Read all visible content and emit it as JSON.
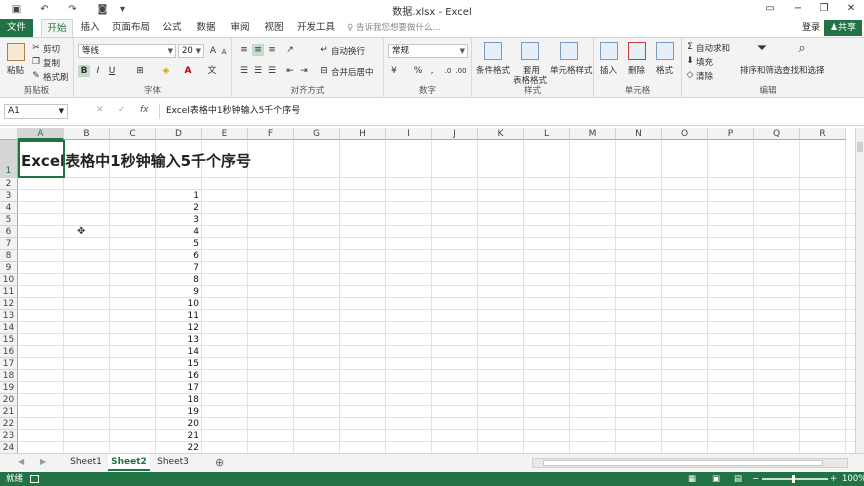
{
  "window": {
    "title": "数据.xlsx - Excel"
  },
  "tabs": [
    "文件",
    "开始",
    "插入",
    "页面布局",
    "公式",
    "数据",
    "审阅",
    "视图",
    "开发工具"
  ],
  "tell_me": "告诉我您想要做什么...",
  "account": {
    "login": "登录",
    "share": "共享"
  },
  "ribbon": {
    "clipboard": {
      "paste": "粘贴",
      "cut": "剪切",
      "copy": "复制",
      "format_painter": "格式刷",
      "label": "剪贴板"
    },
    "font": {
      "name": "等线",
      "size": "20",
      "bold": "B",
      "italic": "I",
      "underline": "U",
      "label": "字体"
    },
    "alignment": {
      "wrap": "自动换行",
      "merge": "合并后居中",
      "label": "对齐方式"
    },
    "number": {
      "format": "常规",
      "percent": "%",
      "comma": ",",
      "label": "数字"
    },
    "styles": {
      "conditional": "条件格式",
      "table_l1": "套用",
      "table_l2": "表格格式",
      "cell_styles": "单元格样式",
      "label": "样式"
    },
    "cells": {
      "insert": "插入",
      "delete": "删除",
      "format": "格式",
      "label": "单元格"
    },
    "editing": {
      "autosum": "自动求和",
      "fill": "填充",
      "clear": "清除",
      "sort": "排序和筛选",
      "find": "查找和选择",
      "label": "编辑"
    }
  },
  "formula_bar": {
    "name_box": "A1",
    "fx": "fx",
    "content": "Excel表格中1秒钟输入5千个序号"
  },
  "columns": [
    "A",
    "B",
    "C",
    "D",
    "E",
    "F",
    "G",
    "H",
    "I",
    "J",
    "K",
    "L",
    "M",
    "N",
    "O",
    "P",
    "Q",
    "R"
  ],
  "rows": [
    "1",
    "2",
    "3",
    "4",
    "5",
    "6",
    "7",
    "8",
    "9",
    "10",
    "11",
    "12",
    "13",
    "14",
    "15",
    "16",
    "17",
    "18",
    "19",
    "20",
    "21",
    "22",
    "23",
    "24"
  ],
  "title_cell": "Excel表格中1秒钟输入5千个序号",
  "d_values": [
    "1",
    "2",
    "3",
    "4",
    "5",
    "6",
    "7",
    "8",
    "9",
    "10",
    "11",
    "12",
    "13",
    "14",
    "15",
    "16",
    "17",
    "18",
    "19",
    "20",
    "21",
    "22"
  ],
  "sheets": [
    "Sheet1",
    "Sheet2",
    "Sheet3"
  ],
  "active_sheet": "Sheet2",
  "status": {
    "ready": "就绪",
    "zoom": "100%"
  },
  "colors": {
    "accent": "#217346"
  }
}
